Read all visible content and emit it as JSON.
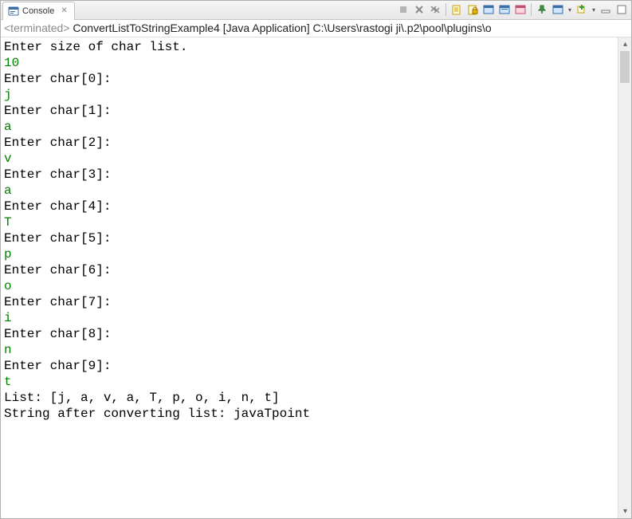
{
  "tab": {
    "title": "Console",
    "close_glyph": "✕"
  },
  "toolbar": {
    "dropdown_glyph": "▾"
  },
  "status": {
    "prefix": "<terminated>",
    "text": " ConvertListToStringExample4 [Java Application] C:\\Users\\rastogi ji\\.p2\\pool\\plugins\\o"
  },
  "console": {
    "lines": [
      {
        "t": "Enter size of char list.",
        "c": "out"
      },
      {
        "t": "10",
        "c": "inp"
      },
      {
        "t": "Enter char[0]:",
        "c": "out"
      },
      {
        "t": "j",
        "c": "inp"
      },
      {
        "t": "Enter char[1]:",
        "c": "out"
      },
      {
        "t": "a",
        "c": "inp"
      },
      {
        "t": "Enter char[2]:",
        "c": "out"
      },
      {
        "t": "v",
        "c": "inp"
      },
      {
        "t": "Enter char[3]:",
        "c": "out"
      },
      {
        "t": "a",
        "c": "inp"
      },
      {
        "t": "Enter char[4]:",
        "c": "out"
      },
      {
        "t": "T",
        "c": "inp"
      },
      {
        "t": "Enter char[5]:",
        "c": "out"
      },
      {
        "t": "p",
        "c": "inp"
      },
      {
        "t": "Enter char[6]:",
        "c": "out"
      },
      {
        "t": "o",
        "c": "inp"
      },
      {
        "t": "Enter char[7]:",
        "c": "out"
      },
      {
        "t": "i",
        "c": "inp"
      },
      {
        "t": "Enter char[8]:",
        "c": "out"
      },
      {
        "t": "n",
        "c": "inp"
      },
      {
        "t": "Enter char[9]:",
        "c": "out"
      },
      {
        "t": "t",
        "c": "inp"
      },
      {
        "t": "List: [j, a, v, a, T, p, o, i, n, t]",
        "c": "out"
      },
      {
        "t": "String after converting list: javaTpoint",
        "c": "out"
      }
    ]
  },
  "scrollbar": {
    "up_glyph": "▴",
    "down_glyph": "▾"
  }
}
